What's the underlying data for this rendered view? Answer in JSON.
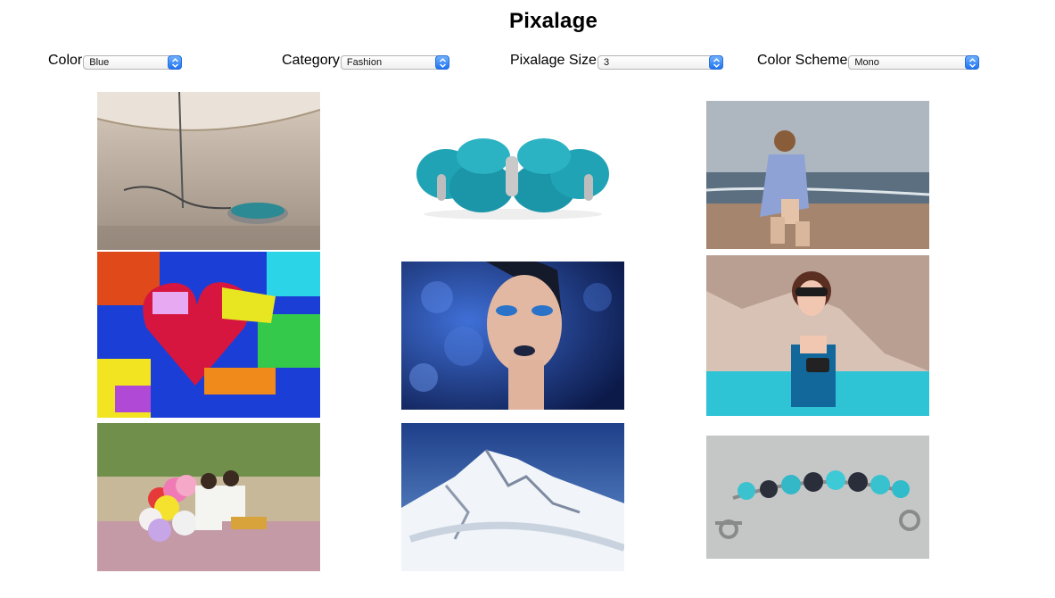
{
  "app": {
    "title": "Pixalage"
  },
  "controls": {
    "color": {
      "label": "Color",
      "value": "Blue"
    },
    "category": {
      "label": "Category",
      "value": "Fashion"
    },
    "size": {
      "label": "Pixalage Size",
      "value": "3"
    },
    "scheme": {
      "label": "Color Scheme",
      "value": "Mono"
    }
  },
  "accent_colors": {
    "select_arrow": "#2f84f5",
    "turquoise": "#1fa3b5",
    "sky_blue": "#1e3f8a"
  },
  "gallery": {
    "columns": 3,
    "images": [
      {
        "column": 1,
        "row": 1,
        "subject": "necklace-pendant-photo"
      },
      {
        "column": 1,
        "row": 2,
        "subject": "graffiti-heart-photo"
      },
      {
        "column": 1,
        "row": 3,
        "subject": "couple-balloons-photo"
      },
      {
        "column": 2,
        "row": 1,
        "subject": "turquoise-bracelet-photo"
      },
      {
        "column": 2,
        "row": 2,
        "subject": "blue-makeup-portrait-photo"
      },
      {
        "column": 2,
        "row": 3,
        "subject": "snowy-mountain-photo"
      },
      {
        "column": 3,
        "row": 1,
        "subject": "beach-woman-photo"
      },
      {
        "column": 3,
        "row": 2,
        "subject": "woman-sunglasses-pool-photo"
      },
      {
        "column": 3,
        "row": 3,
        "subject": "gemstone-bracelet-photo"
      }
    ]
  }
}
